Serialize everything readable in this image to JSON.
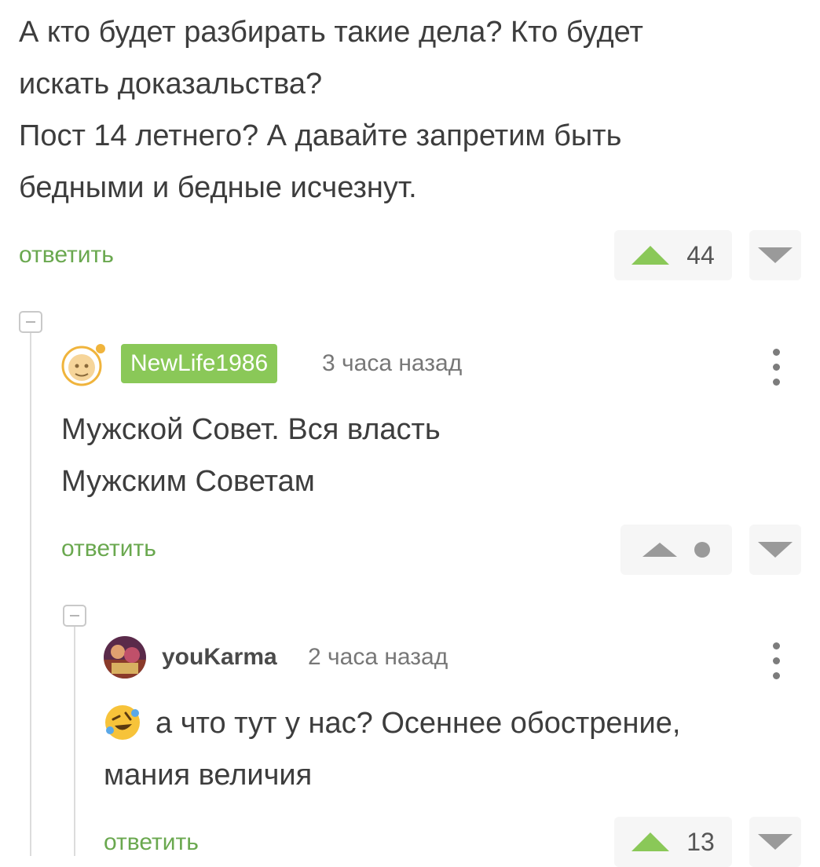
{
  "parent_comment": {
    "lines": [
      "А кто будет разбирать такие дела? Кто будет",
      "искать доказальства?",
      "Пост 14 летнего? А давайте запретим быть",
      "бедными и бедные исчезнут."
    ],
    "reply_label": "ответить",
    "rating": "44"
  },
  "comment_1": {
    "username": "NewLife1986",
    "time": "3 часа назад",
    "lines": [
      "Мужской Совет. Вся власть",
      "Мужским Советам"
    ],
    "reply_label": "ответить"
  },
  "comment_2": {
    "username": "youKarma",
    "time": "2 часа назад",
    "lines": [
      "а что тут у нас? Осеннее обострение,",
      "мания величия"
    ],
    "reply_label": "ответить",
    "rating": "13"
  },
  "colors": {
    "accent_green": "#8ac858",
    "reply_green": "#6aa84f",
    "vote_grey": "#9a9a9a"
  }
}
